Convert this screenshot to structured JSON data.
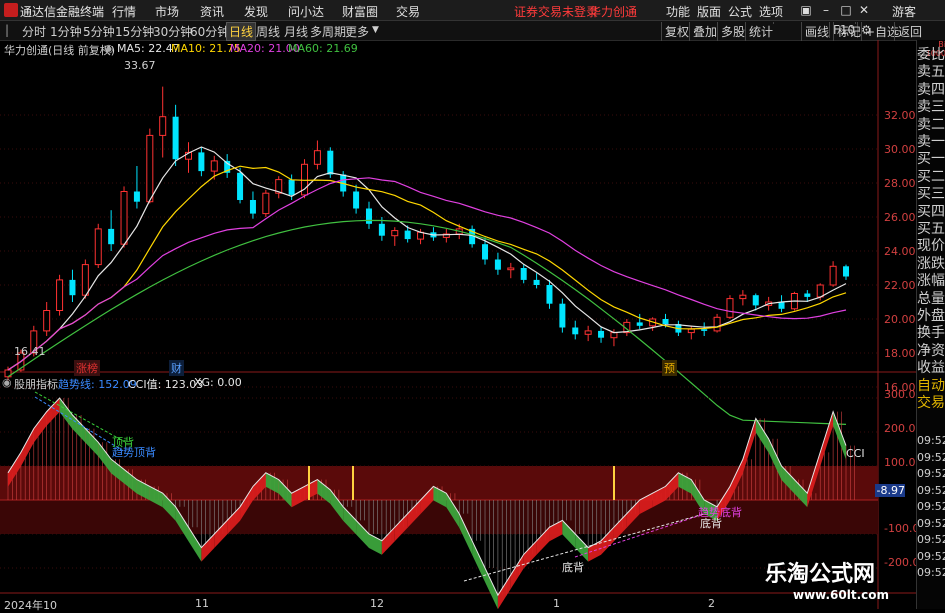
{
  "app": {
    "title": "通达信金融终端",
    "menu": [
      "行情",
      "市场",
      "资讯",
      "发现",
      "问小达",
      "财富圈",
      "交易"
    ],
    "status_text": "证券交易未登录",
    "stock_name": "华力创通",
    "right_menu": [
      "功能",
      "版面",
      "公式",
      "选项"
    ],
    "guest": "游客"
  },
  "toolbar": {
    "periods": [
      "分时",
      "1分钟",
      "5分钟",
      "15分钟",
      "30分钟",
      "60分钟",
      "日线",
      "周线",
      "月线",
      "多周期",
      "更多"
    ],
    "active_period": "日线",
    "right_buttons": [
      "复权",
      "叠加",
      "多股",
      "统计",
      "画线",
      "F10",
      "标记",
      "+自选",
      "返回"
    ]
  },
  "main_chart": {
    "title": "华力创通(日线 前复权)",
    "ma": [
      {
        "label": "MA5: 22.47",
        "color": "#e6e6e6"
      },
      {
        "label": "MA10: 21.75",
        "color": "#ffd700"
      },
      {
        "label": "MA20: 21.00",
        "color": "#e040e0"
      },
      {
        "label": "MA60: 21.69",
        "color": "#40c040"
      }
    ],
    "high_label": "33.67",
    "low_label": "16.41",
    "price_ticks": [
      "32.00",
      "30.00",
      "28.00",
      "26.00",
      "24.00",
      "22.00",
      "20.00",
      "18.00",
      "16.00"
    ],
    "markers": [
      "涨榜",
      "财",
      "预"
    ]
  },
  "indicator": {
    "title": "股朋指标",
    "trend_label": "趋势线: 152.09",
    "cci_label": "CCI值: 123.03",
    "xg_label": "XG: 0.00",
    "ticks": [
      "300.0",
      "200.0",
      "100.0",
      "-8.97",
      "-100.0",
      "-200.0"
    ],
    "annotations": [
      "顶背",
      "趋势顶背",
      "趋势底背",
      "底背",
      "底背",
      "CCI"
    ]
  },
  "dates": [
    "2024年10",
    "11",
    "12",
    "1",
    "2"
  ],
  "right_panel": {
    "items": [
      "委比",
      "卖五",
      "卖四",
      "卖三",
      "卖二",
      "卖一",
      "买一",
      "买二",
      "买三",
      "买四",
      "买五",
      "现价",
      "涨跌",
      "涨幅",
      "总量",
      "外盘",
      "换手",
      "净资",
      "收益",
      "自动",
      "交易"
    ],
    "times": [
      "09:52",
      "09:52",
      "09:52",
      "09:52",
      "09:52",
      "09:52",
      "09:52",
      "09:52",
      "09:52"
    ],
    "top_small": [
      "Bi",
      "1000"
    ]
  },
  "watermark": {
    "line1": "乐淘公式网",
    "line2": "www.60lt.com"
  },
  "chart_data": {
    "type": "candlestick",
    "title": "华力创通(日线 前复权)",
    "y_range": [
      16,
      33.67
    ],
    "series": [
      {
        "name": "MA5",
        "last": 22.47
      },
      {
        "name": "MA10",
        "last": 21.75
      },
      {
        "name": "MA20",
        "last": 21.0
      },
      {
        "name": "MA60",
        "last": 21.69
      }
    ],
    "candles_approx": [
      [
        16.6,
        17.2,
        16.4,
        17.0
      ],
      [
        17.0,
        18.2,
        16.9,
        18.0
      ],
      [
        18.0,
        19.6,
        17.8,
        19.3
      ],
      [
        19.3,
        21.0,
        19.0,
        20.5
      ],
      [
        20.5,
        22.6,
        20.2,
        22.3
      ],
      [
        22.3,
        22.9,
        21.0,
        21.4
      ],
      [
        21.4,
        23.5,
        21.2,
        23.2
      ],
      [
        23.2,
        25.6,
        23.0,
        25.3
      ],
      [
        25.3,
        26.4,
        24.0,
        24.4
      ],
      [
        24.4,
        27.8,
        24.2,
        27.5
      ],
      [
        27.5,
        29.0,
        26.5,
        26.9
      ],
      [
        26.9,
        31.2,
        26.8,
        30.8
      ],
      [
        30.8,
        33.67,
        29.5,
        31.9
      ],
      [
        31.9,
        32.6,
        29.0,
        29.4
      ],
      [
        29.4,
        30.4,
        28.6,
        29.8
      ],
      [
        29.8,
        30.1,
        28.4,
        28.7
      ],
      [
        28.7,
        29.6,
        28.2,
        29.3
      ],
      [
        29.3,
        29.7,
        28.3,
        28.6
      ],
      [
        28.6,
        28.9,
        26.8,
        27.0
      ],
      [
        27.0,
        27.5,
        25.9,
        26.2
      ],
      [
        26.2,
        27.6,
        26.0,
        27.4
      ],
      [
        27.4,
        28.4,
        27.1,
        28.2
      ],
      [
        28.2,
        28.5,
        27.0,
        27.3
      ],
      [
        27.3,
        29.4,
        27.1,
        29.1
      ],
      [
        29.1,
        30.5,
        28.8,
        29.9
      ],
      [
        29.9,
        30.1,
        28.3,
        28.5
      ],
      [
        28.5,
        28.7,
        27.2,
        27.5
      ],
      [
        27.5,
        27.9,
        26.2,
        26.5
      ],
      [
        26.5,
        26.9,
        25.3,
        25.6
      ],
      [
        25.6,
        26.0,
        24.6,
        24.9
      ],
      [
        24.9,
        25.4,
        24.3,
        25.2
      ],
      [
        25.2,
        25.5,
        24.5,
        24.7
      ],
      [
        24.7,
        25.3,
        24.4,
        25.1
      ],
      [
        25.1,
        25.4,
        24.6,
        24.8
      ],
      [
        24.8,
        25.3,
        24.5,
        25.0
      ],
      [
        25.0,
        25.6,
        24.7,
        25.3
      ],
      [
        25.3,
        25.5,
        24.2,
        24.4
      ],
      [
        24.4,
        24.8,
        23.2,
        23.5
      ],
      [
        23.5,
        23.9,
        22.6,
        22.9
      ],
      [
        22.9,
        23.3,
        22.4,
        23.0
      ],
      [
        23.0,
        23.2,
        22.1,
        22.3
      ],
      [
        22.3,
        22.7,
        21.8,
        22.0
      ],
      [
        22.0,
        22.3,
        20.6,
        20.9
      ],
      [
        20.9,
        21.2,
        19.2,
        19.5
      ],
      [
        19.5,
        19.9,
        18.8,
        19.1
      ],
      [
        19.1,
        19.6,
        18.7,
        19.3
      ],
      [
        19.3,
        19.5,
        18.6,
        18.9
      ],
      [
        18.9,
        19.4,
        18.4,
        19.2
      ],
      [
        19.2,
        20.0,
        19.0,
        19.8
      ],
      [
        19.8,
        20.3,
        19.4,
        19.6
      ],
      [
        19.6,
        20.1,
        19.3,
        20.0
      ],
      [
        20.0,
        20.3,
        19.5,
        19.7
      ],
      [
        19.7,
        19.9,
        19.0,
        19.2
      ],
      [
        19.2,
        19.6,
        18.8,
        19.4
      ],
      [
        19.4,
        19.8,
        19.0,
        19.3
      ],
      [
        19.3,
        20.3,
        19.2,
        20.1
      ],
      [
        20.1,
        21.4,
        20.0,
        21.2
      ],
      [
        21.2,
        21.7,
        20.8,
        21.4
      ],
      [
        21.4,
        21.5,
        20.5,
        20.8
      ],
      [
        20.8,
        21.3,
        20.5,
        21.0
      ],
      [
        21.0,
        21.4,
        20.4,
        20.6
      ],
      [
        20.6,
        21.6,
        20.5,
        21.5
      ],
      [
        21.5,
        21.7,
        21.0,
        21.3
      ],
      [
        21.3,
        22.1,
        21.1,
        22.0
      ],
      [
        22.0,
        23.4,
        21.9,
        23.1
      ],
      [
        23.1,
        23.2,
        22.3,
        22.5
      ]
    ]
  }
}
